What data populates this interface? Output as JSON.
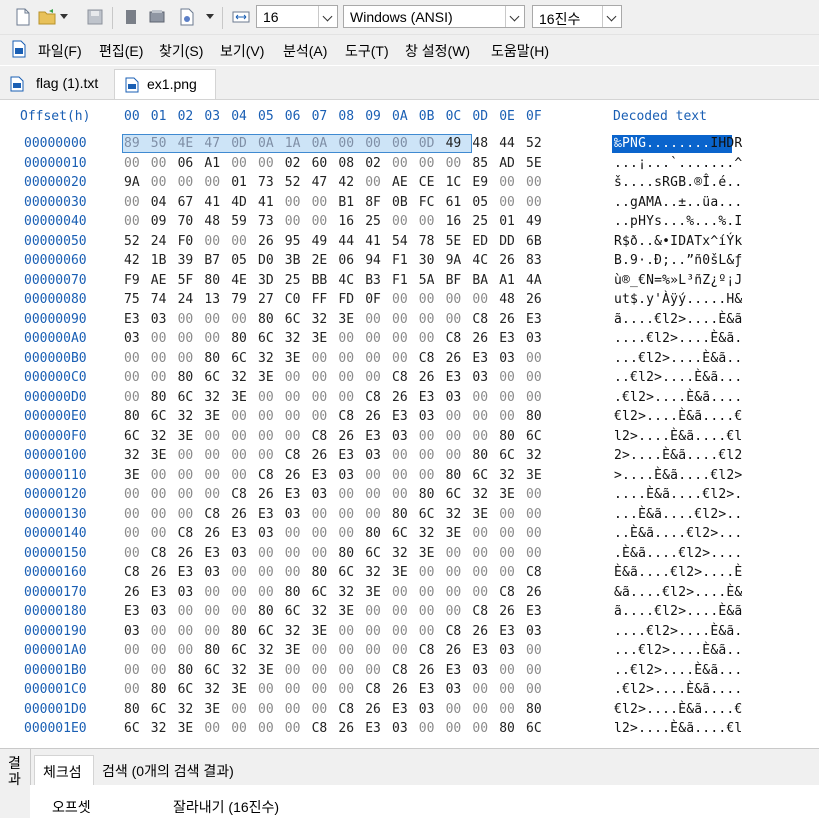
{
  "toolbar": {
    "font_size": "16",
    "encoding": "Windows (ANSI)",
    "number_base": "16진수"
  },
  "menu": [
    "파일(F)",
    "편집(E)",
    "찾기(S)",
    "보기(V)",
    "분석(A)",
    "도구(T)",
    "창 설정(W)",
    "도움말(H)"
  ],
  "tabs": [
    {
      "label": "flag (1).txt",
      "active": false
    },
    {
      "label": "ex1.png",
      "active": true
    }
  ],
  "hex": {
    "offset_header": "Offset(h)",
    "decoded_header": "Decoded text",
    "columns": [
      "00",
      "01",
      "02",
      "03",
      "04",
      "05",
      "06",
      "07",
      "08",
      "09",
      "0A",
      "0B",
      "0C",
      "0D",
      "0E",
      "0F"
    ],
    "rows": [
      {
        "offset": "00000000",
        "bytes": [
          "89",
          "50",
          "4E",
          "47",
          "0D",
          "0A",
          "1A",
          "0A",
          "00",
          "00",
          "00",
          "0D",
          "49",
          "48",
          "44",
          "52"
        ],
        "text": "‰PNG........IHDR"
      },
      {
        "offset": "00000010",
        "bytes": [
          "00",
          "00",
          "06",
          "A1",
          "00",
          "00",
          "02",
          "60",
          "08",
          "02",
          "00",
          "00",
          "00",
          "85",
          "AD",
          "5E"
        ],
        "text": "...¡...`.......^"
      },
      {
        "offset": "00000020",
        "bytes": [
          "9A",
          "00",
          "00",
          "00",
          "01",
          "73",
          "52",
          "47",
          "42",
          "00",
          "AE",
          "CE",
          "1C",
          "E9",
          "00",
          "00"
        ],
        "text": "š....sRGB.®Î.é.."
      },
      {
        "offset": "00000030",
        "bytes": [
          "00",
          "04",
          "67",
          "41",
          "4D",
          "41",
          "00",
          "00",
          "B1",
          "8F",
          "0B",
          "FC",
          "61",
          "05",
          "00",
          "00"
        ],
        "text": "..gAMA..±..üa..."
      },
      {
        "offset": "00000040",
        "bytes": [
          "00",
          "09",
          "70",
          "48",
          "59",
          "73",
          "00",
          "00",
          "16",
          "25",
          "00",
          "00",
          "16",
          "25",
          "01",
          "49"
        ],
        "text": "..pHYs...%...%.I"
      },
      {
        "offset": "00000050",
        "bytes": [
          "52",
          "24",
          "F0",
          "00",
          "00",
          "26",
          "95",
          "49",
          "44",
          "41",
          "54",
          "78",
          "5E",
          "ED",
          "DD",
          "6B"
        ],
        "text": "R$ð..&•IDATx^íÝk"
      },
      {
        "offset": "00000060",
        "bytes": [
          "42",
          "1B",
          "39",
          "B7",
          "05",
          "D0",
          "3B",
          "2E",
          "06",
          "94",
          "F1",
          "30",
          "9A",
          "4C",
          "26",
          "83"
        ],
        "text": "B.9·.Ð;..”ñ0šL&ƒ"
      },
      {
        "offset": "00000070",
        "bytes": [
          "F9",
          "AE",
          "5F",
          "80",
          "4E",
          "3D",
          "25",
          "BB",
          "4C",
          "B3",
          "F1",
          "5A",
          "BF",
          "BA",
          "A1",
          "4A"
        ],
        "text": "ù®_€N=%»L³ñZ¿º¡J"
      },
      {
        "offset": "00000080",
        "bytes": [
          "75",
          "74",
          "24",
          "13",
          "79",
          "27",
          "C0",
          "FF",
          "FD",
          "0F",
          "00",
          "00",
          "00",
          "00",
          "48",
          "26"
        ],
        "text": "ut$.y'Àÿý.....H&"
      },
      {
        "offset": "00000090",
        "bytes": [
          "E3",
          "03",
          "00",
          "00",
          "00",
          "80",
          "6C",
          "32",
          "3E",
          "00",
          "00",
          "00",
          "00",
          "C8",
          "26",
          "E3"
        ],
        "text": "ã....€l2>....È&ã"
      },
      {
        "offset": "000000A0",
        "bytes": [
          "03",
          "00",
          "00",
          "00",
          "80",
          "6C",
          "32",
          "3E",
          "00",
          "00",
          "00",
          "00",
          "C8",
          "26",
          "E3",
          "03"
        ],
        "text": "....€l2>....È&ã."
      },
      {
        "offset": "000000B0",
        "bytes": [
          "00",
          "00",
          "00",
          "80",
          "6C",
          "32",
          "3E",
          "00",
          "00",
          "00",
          "00",
          "C8",
          "26",
          "E3",
          "03",
          "00"
        ],
        "text": "...€l2>....È&ã.."
      },
      {
        "offset": "000000C0",
        "bytes": [
          "00",
          "00",
          "80",
          "6C",
          "32",
          "3E",
          "00",
          "00",
          "00",
          "00",
          "C8",
          "26",
          "E3",
          "03",
          "00",
          "00"
        ],
        "text": "..€l2>....È&ã..."
      },
      {
        "offset": "000000D0",
        "bytes": [
          "00",
          "80",
          "6C",
          "32",
          "3E",
          "00",
          "00",
          "00",
          "00",
          "C8",
          "26",
          "E3",
          "03",
          "00",
          "00",
          "00"
        ],
        "text": ".€l2>....È&ã...."
      },
      {
        "offset": "000000E0",
        "bytes": [
          "80",
          "6C",
          "32",
          "3E",
          "00",
          "00",
          "00",
          "00",
          "C8",
          "26",
          "E3",
          "03",
          "00",
          "00",
          "00",
          "80"
        ],
        "text": "€l2>....È&ã....€"
      },
      {
        "offset": "000000F0",
        "bytes": [
          "6C",
          "32",
          "3E",
          "00",
          "00",
          "00",
          "00",
          "C8",
          "26",
          "E3",
          "03",
          "00",
          "00",
          "00",
          "80",
          "6C"
        ],
        "text": "l2>....È&ã....€l"
      },
      {
        "offset": "00000100",
        "bytes": [
          "32",
          "3E",
          "00",
          "00",
          "00",
          "00",
          "C8",
          "26",
          "E3",
          "03",
          "00",
          "00",
          "00",
          "80",
          "6C",
          "32"
        ],
        "text": "2>....È&ã....€l2"
      },
      {
        "offset": "00000110",
        "bytes": [
          "3E",
          "00",
          "00",
          "00",
          "00",
          "C8",
          "26",
          "E3",
          "03",
          "00",
          "00",
          "00",
          "80",
          "6C",
          "32",
          "3E"
        ],
        "text": ">....È&ã....€l2>"
      },
      {
        "offset": "00000120",
        "bytes": [
          "00",
          "00",
          "00",
          "00",
          "C8",
          "26",
          "E3",
          "03",
          "00",
          "00",
          "00",
          "80",
          "6C",
          "32",
          "3E",
          "00"
        ],
        "text": "....È&ã....€l2>."
      },
      {
        "offset": "00000130",
        "bytes": [
          "00",
          "00",
          "00",
          "C8",
          "26",
          "E3",
          "03",
          "00",
          "00",
          "00",
          "80",
          "6C",
          "32",
          "3E",
          "00",
          "00"
        ],
        "text": "...È&ã....€l2>.."
      },
      {
        "offset": "00000140",
        "bytes": [
          "00",
          "00",
          "C8",
          "26",
          "E3",
          "03",
          "00",
          "00",
          "00",
          "80",
          "6C",
          "32",
          "3E",
          "00",
          "00",
          "00"
        ],
        "text": "..È&ã....€l2>..."
      },
      {
        "offset": "00000150",
        "bytes": [
          "00",
          "C8",
          "26",
          "E3",
          "03",
          "00",
          "00",
          "00",
          "80",
          "6C",
          "32",
          "3E",
          "00",
          "00",
          "00",
          "00"
        ],
        "text": ".È&ã....€l2>...."
      },
      {
        "offset": "00000160",
        "bytes": [
          "C8",
          "26",
          "E3",
          "03",
          "00",
          "00",
          "00",
          "80",
          "6C",
          "32",
          "3E",
          "00",
          "00",
          "00",
          "00",
          "C8"
        ],
        "text": "È&ã....€l2>....È"
      },
      {
        "offset": "00000170",
        "bytes": [
          "26",
          "E3",
          "03",
          "00",
          "00",
          "00",
          "80",
          "6C",
          "32",
          "3E",
          "00",
          "00",
          "00",
          "00",
          "C8",
          "26"
        ],
        "text": "&ã....€l2>....È&"
      },
      {
        "offset": "00000180",
        "bytes": [
          "E3",
          "03",
          "00",
          "00",
          "00",
          "80",
          "6C",
          "32",
          "3E",
          "00",
          "00",
          "00",
          "00",
          "C8",
          "26",
          "E3"
        ],
        "text": "ã....€l2>....È&ã"
      },
      {
        "offset": "00000190",
        "bytes": [
          "03",
          "00",
          "00",
          "00",
          "80",
          "6C",
          "32",
          "3E",
          "00",
          "00",
          "00",
          "00",
          "C8",
          "26",
          "E3",
          "03"
        ],
        "text": "....€l2>....È&ã."
      },
      {
        "offset": "000001A0",
        "bytes": [
          "00",
          "00",
          "00",
          "80",
          "6C",
          "32",
          "3E",
          "00",
          "00",
          "00",
          "00",
          "C8",
          "26",
          "E3",
          "03",
          "00"
        ],
        "text": "...€l2>....È&ã.."
      },
      {
        "offset": "000001B0",
        "bytes": [
          "00",
          "00",
          "80",
          "6C",
          "32",
          "3E",
          "00",
          "00",
          "00",
          "00",
          "C8",
          "26",
          "E3",
          "03",
          "00",
          "00"
        ],
        "text": "..€l2>....È&ã..."
      },
      {
        "offset": "000001C0",
        "bytes": [
          "00",
          "80",
          "6C",
          "32",
          "3E",
          "00",
          "00",
          "00",
          "00",
          "C8",
          "26",
          "E3",
          "03",
          "00",
          "00",
          "00"
        ],
        "text": ".€l2>....È&ã...."
      },
      {
        "offset": "000001D0",
        "bytes": [
          "80",
          "6C",
          "32",
          "3E",
          "00",
          "00",
          "00",
          "00",
          "C8",
          "26",
          "E3",
          "03",
          "00",
          "00",
          "00",
          "80"
        ],
        "text": "€l2>....È&ã....€"
      },
      {
        "offset": "000001E0",
        "bytes": [
          "6C",
          "32",
          "3E",
          "00",
          "00",
          "00",
          "00",
          "C8",
          "26",
          "E3",
          "03",
          "00",
          "00",
          "00",
          "80",
          "6C"
        ],
        "text": "l2>....È&ã....€l"
      }
    ]
  },
  "bottom_panel": {
    "side_label": "결과",
    "tabs": [
      {
        "label": "체크섬",
        "active": true
      },
      {
        "label": "검색 (0개의 검색 결과)",
        "active": false
      }
    ],
    "columns": [
      "오프셋",
      "잘라내기 (16진수)"
    ]
  },
  "colors": {
    "accent_blue": "#1a5fb4",
    "selection_fill": "#cde4f7",
    "selection_text_bg": "#0a64cc"
  }
}
